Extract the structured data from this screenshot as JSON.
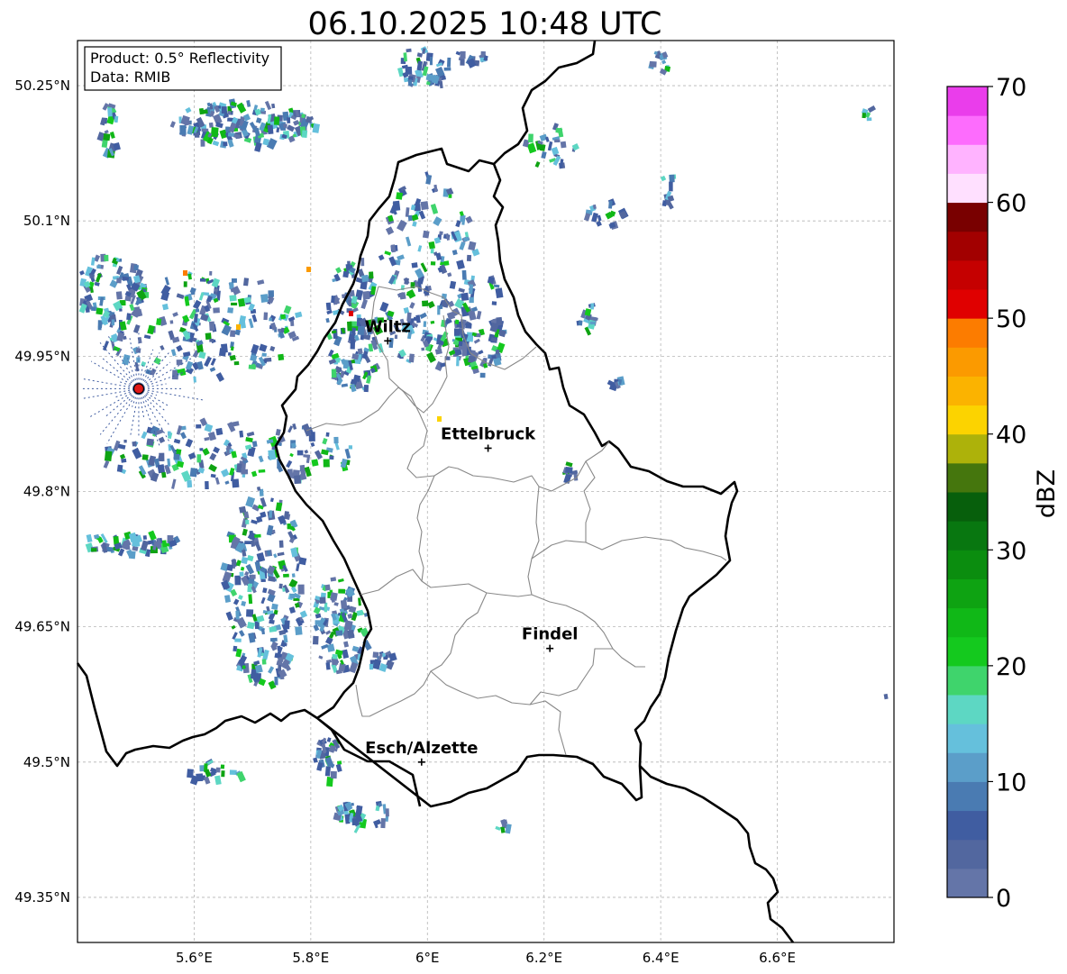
{
  "title": "06.10.2025 10:48 UTC",
  "info_box": {
    "product": "Product: 0.5° Reflectivity",
    "data": "Data: RMIB"
  },
  "map": {
    "lon_range": [
      5.4,
      6.8
    ],
    "lat_range": [
      49.3,
      50.3
    ],
    "lon_ticks": [
      "5.6°E",
      "5.8°E",
      "6°E",
      "6.2°E",
      "6.4°E",
      "6.6°E"
    ],
    "lat_ticks": [
      "50.25°N",
      "50.1°N",
      "49.95°N",
      "49.8°N",
      "49.65°N",
      "49.5°N",
      "49.35°N"
    ],
    "grid": true,
    "radar_site": {
      "lon": 5.505,
      "lat": 49.914,
      "color": "#e01818"
    },
    "cities": [
      {
        "name": "Wiltz",
        "lon": 5.932,
        "lat": 49.967
      },
      {
        "name": "Ettelbruck",
        "lon": 6.104,
        "lat": 49.848
      },
      {
        "name": "Findel",
        "lon": 6.21,
        "lat": 49.626
      },
      {
        "name": "Esch/Alzette",
        "lon": 5.99,
        "lat": 49.5
      }
    ]
  },
  "colorbar": {
    "label": "dBZ",
    "ticks": [
      "0",
      "10",
      "20",
      "30",
      "40",
      "50",
      "60",
      "70"
    ],
    "vmin": 0,
    "vmax": 70,
    "step": 2.5,
    "colors": [
      "#6475a8",
      "#52679f",
      "#405da1",
      "#4a7bb2",
      "#5b9ec9",
      "#65c0dc",
      "#5dd7c3",
      "#3fd46c",
      "#14c91e",
      "#10b817",
      "#0ea312",
      "#0b8d0f",
      "#087710",
      "#075f0c",
      "#45760d",
      "#adb20a",
      "#fcd300",
      "#fbb300",
      "#fb9a00",
      "#fc7c00",
      "#e00000",
      "#c50000",
      "#a20000",
      "#790000",
      "#ffe0ff",
      "#ffb3ff",
      "#fd6cfd",
      "#ea3deb"
    ]
  }
}
